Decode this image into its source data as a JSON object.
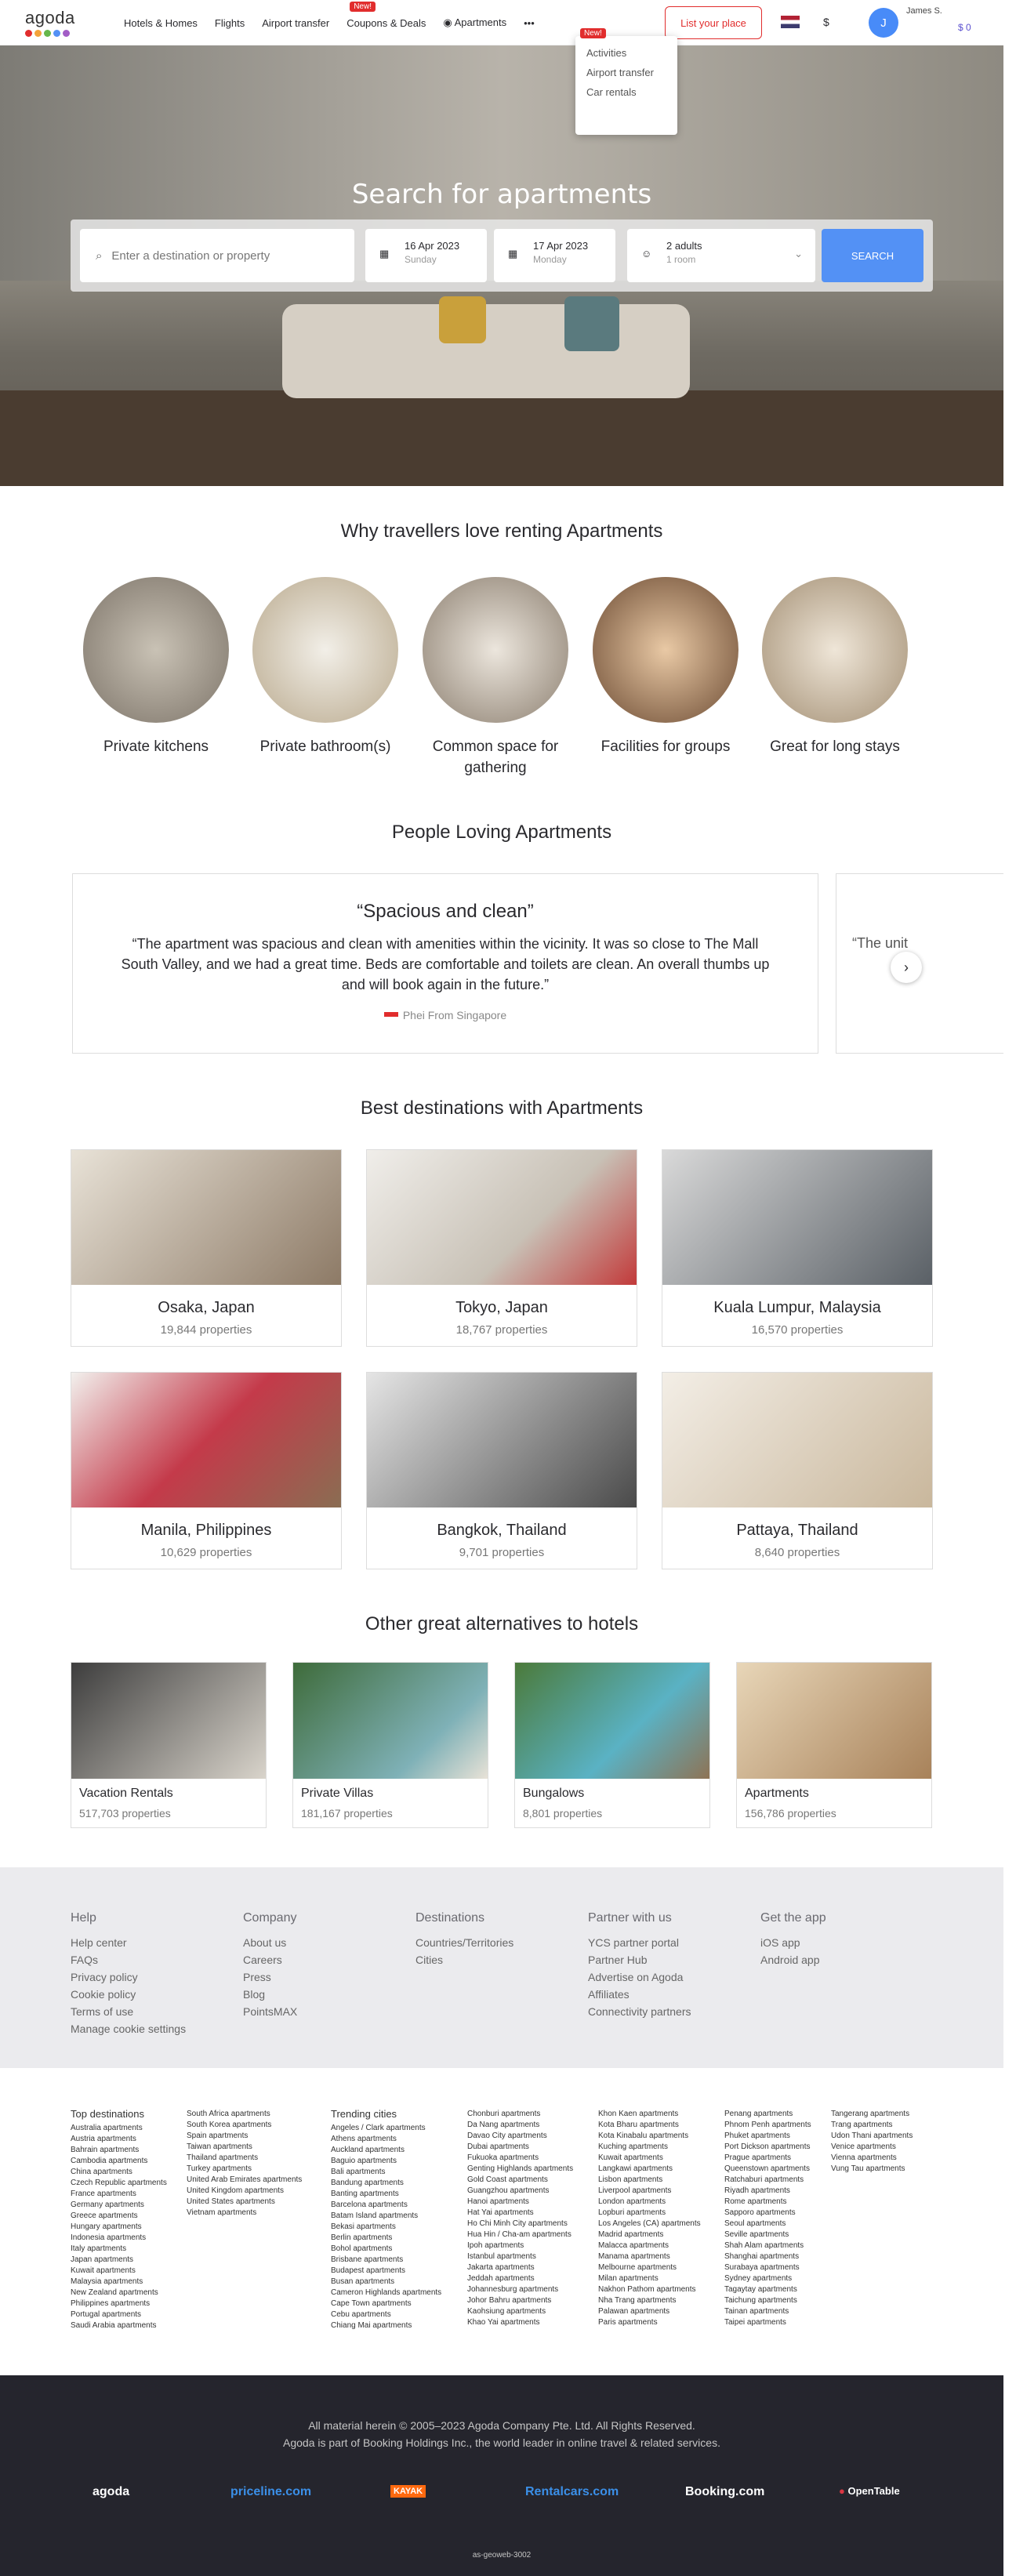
{
  "header": {
    "logo": "agoda",
    "nav": [
      "Hotels & Homes",
      "Flights",
      "Airport transfer",
      "Coupons & Deals",
      "Apartments"
    ],
    "new_badge": "New!",
    "more": "•••",
    "list_your_place": "List your place",
    "currency": "$",
    "avatar_initial": "J",
    "user_name": "James S.",
    "balance": "$ 0"
  },
  "dropdown": {
    "badge": "New!",
    "items": [
      "Activities",
      "Airport transfer",
      "Car rentals"
    ]
  },
  "hero": {
    "title": "Search for apartments",
    "destination_placeholder": "Enter a destination or property",
    "checkin_date": "16 Apr 2023",
    "checkin_day": "Sunday",
    "checkout_date": "17 Apr 2023",
    "checkout_day": "Monday",
    "guests": "2 adults",
    "rooms": "1 room",
    "search": "SEARCH"
  },
  "why": {
    "title": "Why travellers love renting Apartments",
    "items": [
      "Private kitchens",
      "Private bathroom(s)",
      "Common space for gathering",
      "Facilities for groups",
      "Great for long stays"
    ]
  },
  "reviews": {
    "title": "People Loving Apartments",
    "headline": "“Spacious and clean”",
    "quote": "“The apartment was spacious and clean with amenities within the vicinity. It was so close to The Mall South Valley, and we had a great time. Beds are comfortable and toilets are clean. An overall thumbs up and will book again in the future.”",
    "author": "Phei From Singapore",
    "next_preview": "“The unit"
  },
  "best": {
    "title": "Best destinations with Apartments",
    "cards": [
      {
        "name": "Osaka, Japan",
        "props": "19,844 properties"
      },
      {
        "name": "Tokyo, Japan",
        "props": "18,767 properties"
      },
      {
        "name": "Kuala Lumpur, Malaysia",
        "props": "16,570 properties"
      },
      {
        "name": "Manila, Philippines",
        "props": "10,629 properties"
      },
      {
        "name": "Bangkok, Thailand",
        "props": "9,701 properties"
      },
      {
        "name": "Pattaya, Thailand",
        "props": "8,640 properties"
      }
    ]
  },
  "alts": {
    "title": "Other great alternatives to hotels",
    "cards": [
      {
        "name": "Vacation Rentals",
        "props": "517,703 properties"
      },
      {
        "name": "Private Villas",
        "props": "181,167 properties"
      },
      {
        "name": "Bungalows",
        "props": "8,801 properties"
      },
      {
        "name": "Apartments",
        "props": "156,786 properties"
      }
    ]
  },
  "help": {
    "cols": [
      {
        "h": "Help",
        "items": [
          "Help center",
          "FAQs",
          "Privacy policy",
          "Cookie policy",
          "Terms of use",
          "Manage cookie settings"
        ]
      },
      {
        "h": "Company",
        "items": [
          "About us",
          "Careers",
          "Press",
          "Blog",
          "PointsMAX"
        ]
      },
      {
        "h": "Destinations",
        "items": [
          "Countries/Territories",
          "Cities"
        ]
      },
      {
        "h": "Partner with us",
        "items": [
          "YCS partner portal",
          "Partner Hub",
          "Advertise on Agoda",
          "Affiliates",
          "Connectivity partners"
        ]
      },
      {
        "h": "Get the app",
        "items": [
          "iOS app",
          "Android app"
        ]
      }
    ]
  },
  "links": {
    "top_title": "Top destinations",
    "trend_title": "Trending cities",
    "top1": [
      "Australia apartments",
      "Austria apartments",
      "Bahrain apartments",
      "Cambodia apartments",
      "China apartments",
      "Czech Republic apartments",
      "France apartments",
      "Germany apartments",
      "Greece apartments",
      "Hungary apartments",
      "Indonesia apartments",
      "Italy apartments",
      "Japan apartments",
      "Kuwait apartments",
      "Malaysia apartments",
      "New Zealand apartments",
      "Philippines apartments",
      "Portugal apartments",
      "Saudi Arabia apartments"
    ],
    "top2": [
      "South Africa apartments",
      "South Korea apartments",
      "Spain apartments",
      "Taiwan apartments",
      "Thailand apartments",
      "Turkey apartments",
      "United Arab Emirates apartments",
      "United Kingdom apartments",
      "United States apartments",
      "Vietnam apartments"
    ],
    "t1": [
      "Angeles / Clark apartments",
      "Athens apartments",
      "Auckland apartments",
      "Baguio apartments",
      "Bali apartments",
      "Bandung apartments",
      "Banting apartments",
      "Barcelona apartments",
      "Batam Island apartments",
      "Bekasi apartments",
      "Berlin apartments",
      "Bohol apartments",
      "Brisbane apartments",
      "Budapest apartments",
      "Busan apartments",
      "Cameron Highlands apartments",
      "Cape Town apartments",
      "Cebu apartments",
      "Chiang Mai apartments"
    ],
    "t2": [
      "Chonburi apartments",
      "Da Nang apartments",
      "Davao City apartments",
      "Dubai apartments",
      "Fukuoka apartments",
      "Genting Highlands apartments",
      "Gold Coast apartments",
      "Guangzhou apartments",
      "Hanoi apartments",
      "Hat Yai apartments",
      "Ho Chi Minh City apartments",
      "Hua Hin / Cha-am apartments",
      "Ipoh apartments",
      "Istanbul apartments",
      "Jakarta apartments",
      "Jeddah apartments",
      "Johannesburg apartments",
      "Johor Bahru apartments",
      "Kaohsiung apartments",
      "Khao Yai apartments"
    ],
    "t3": [
      "Khon Kaen apartments",
      "Kota Bharu apartments",
      "Kota Kinabalu apartments",
      "Kuching apartments",
      "Kuwait apartments",
      "Langkawi apartments",
      "Lisbon apartments",
      "Liverpool apartments",
      "London apartments",
      "Lopburi apartments",
      "Los Angeles (CA) apartments",
      "Madrid apartments",
      "Malacca apartments",
      "Manama apartments",
      "Melbourne apartments",
      "Milan apartments",
      "Nakhon Pathom apartments",
      "Nha Trang apartments",
      "Palawan apartments",
      "Paris apartments"
    ],
    "t4": [
      "Penang apartments",
      "Phnom Penh apartments",
      "Phuket apartments",
      "Port Dickson apartments",
      "Prague apartments",
      "Queenstown apartments",
      "Ratchaburi apartments",
      "Riyadh apartments",
      "Rome apartments",
      "Sapporo apartments",
      "Seoul apartments",
      "Seville apartments",
      "Shah Alam apartments",
      "Shanghai apartments",
      "Surabaya apartments",
      "Sydney apartments",
      "Tagaytay apartments",
      "Taichung apartments",
      "Tainan apartments",
      "Taipei apartments"
    ],
    "t5": [
      "Tangerang apartments",
      "Trang apartments",
      "Udon Thani apartments",
      "Venice apartments",
      "Vienna apartments",
      "Vung Tau apartments"
    ]
  },
  "footer": {
    "line1": "All material herein © 2005–2023 Agoda Company Pte. Ltd. All Rights Reserved.",
    "line2": "Agoda is part of Booking Holdings Inc., the world leader in online travel & related services.",
    "brands": [
      "agoda",
      "priceline.com",
      "KAYAK",
      "Rentalcars.com",
      "Booking.com",
      "OpenTable"
    ],
    "build": "as-geoweb-3002"
  }
}
